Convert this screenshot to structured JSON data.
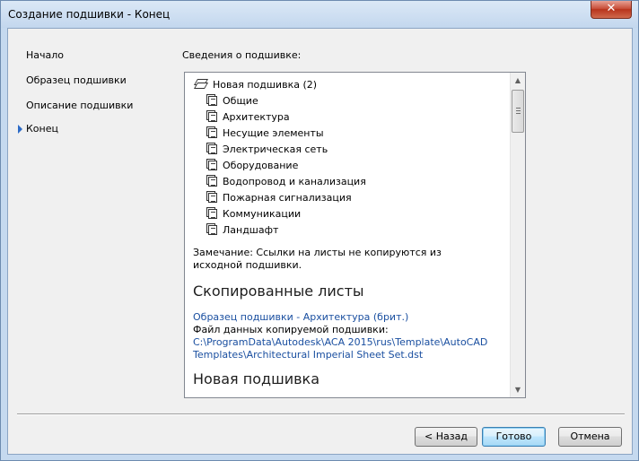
{
  "window": {
    "title": "Создание подшивки - Конец",
    "close_label": "✕"
  },
  "nav": {
    "items": [
      {
        "label": "Начало",
        "current": false
      },
      {
        "label": "Образец подшивки",
        "current": false
      },
      {
        "label": "Описание подшивки",
        "current": false
      },
      {
        "label": "Конец",
        "current": true
      }
    ]
  },
  "details": {
    "section_label": "Сведения о подшивке:",
    "root_label": "Новая подшивка (2)",
    "subsets": [
      "Общие",
      "Архитектура",
      "Несущие элементы",
      "Электрическая сеть",
      "Оборудование",
      "Водопровод и канализация",
      "Пожарная сигнализация",
      "Коммуникации",
      "Ландшафт"
    ],
    "note": "Замечание: Ссылки на листы не копируются из исходной подшивки.",
    "copied_heading": "Скопированные листы",
    "template_link": "Образец подшивки - Архитектура (брит.)",
    "data_file_label": "Файл данных копируемой подшивки:",
    "data_file_path": "C:\\ProgramData\\Autodesk\\ACA 2015\\rus\\Template\\AutoCAD Templates\\Architectural Imperial Sheet Set.dst",
    "new_heading": "Новая подшивка"
  },
  "buttons": {
    "back": "< Назад",
    "finish": "Готово",
    "cancel": "Отмена"
  }
}
